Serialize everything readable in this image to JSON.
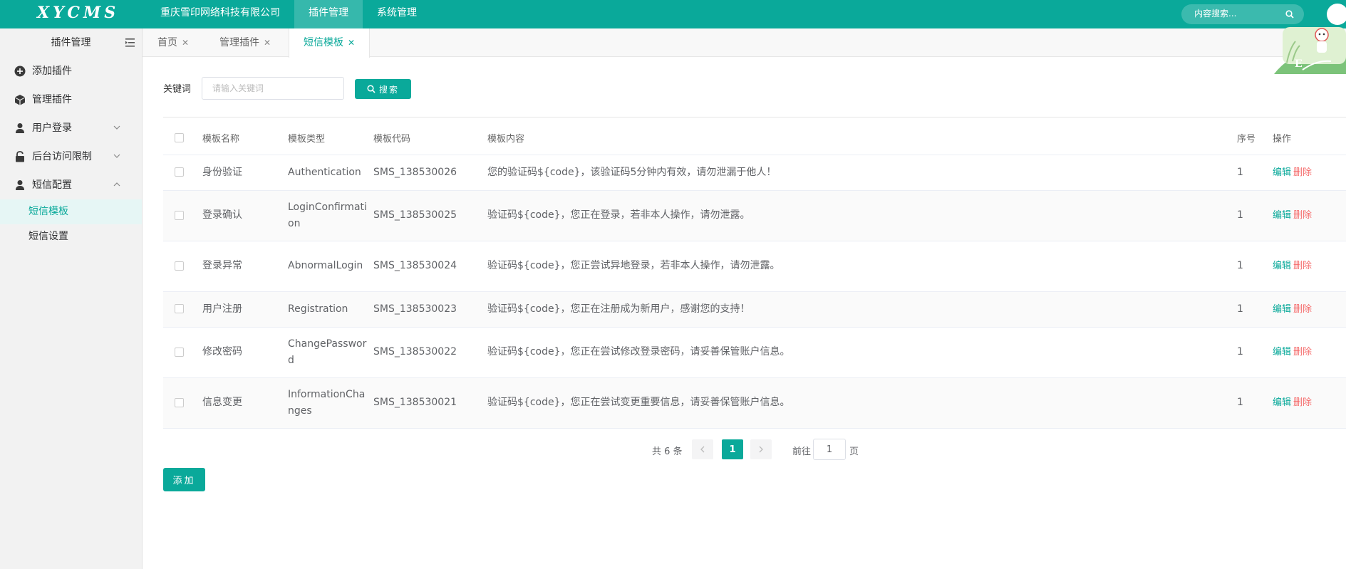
{
  "app": {
    "logo": "XYCMS"
  },
  "topnav": [
    {
      "label": "重庆雪印网络科技有限公司",
      "active": false
    },
    {
      "label": "插件管理",
      "active": true
    },
    {
      "label": "系统管理",
      "active": false
    }
  ],
  "top_search": {
    "placeholder": "内容搜索..."
  },
  "sidebar": {
    "title": "插件管理",
    "items": [
      {
        "label": "添加插件",
        "icon": "plus-circle-icon"
      },
      {
        "label": "管理插件",
        "icon": "cube-icon"
      },
      {
        "label": "用户登录",
        "icon": "user-icon",
        "expandable": true
      },
      {
        "label": "后台访问限制",
        "icon": "lock-icon",
        "expandable": true
      },
      {
        "label": "短信配置",
        "icon": "user-icon",
        "expanded": true
      }
    ],
    "subitems": [
      {
        "label": "短信模板",
        "active": true
      },
      {
        "label": "短信设置",
        "active": false
      }
    ]
  },
  "tabs": [
    {
      "label": "首页",
      "active": false
    },
    {
      "label": "管理插件",
      "active": false
    },
    {
      "label": "短信模板",
      "active": true
    }
  ],
  "filter": {
    "keyword_label": "关键词",
    "keyword_placeholder": "请输入关键词",
    "search_label": "搜索"
  },
  "table": {
    "headers": {
      "name": "模板名称",
      "type": "模板类型",
      "code": "模板代码",
      "content": "模板内容",
      "seq": "序号",
      "ops": "操作"
    },
    "rows": [
      {
        "name": "身份验证",
        "type": "Authentication",
        "code": "SMS_138530026",
        "content": "您的验证码${code}，该验证码5分钟内有效，请勿泄漏于他人！",
        "seq": "1"
      },
      {
        "name": "登录确认",
        "type": "LoginConfirmation",
        "code": "SMS_138530025",
        "content": "验证码${code}，您正在登录，若非本人操作，请勿泄露。",
        "seq": "1"
      },
      {
        "name": "登录异常",
        "type": "AbnormalLogin",
        "code": "SMS_138530024",
        "content": "验证码${code}，您正尝试异地登录，若非本人操作，请勿泄露。",
        "seq": "1"
      },
      {
        "name": "用户注册",
        "type": "Registration",
        "code": "SMS_138530023",
        "content": "验证码${code}，您正在注册成为新用户，感谢您的支持！",
        "seq": "1"
      },
      {
        "name": "修改密码",
        "type": "ChangePassword",
        "code": "SMS_138530022",
        "content": "验证码${code}，您正在尝试修改登录密码，请妥善保管账户信息。",
        "seq": "1"
      },
      {
        "name": "信息变更",
        "type": "InformationChanges",
        "code": "SMS_138530021",
        "content": "验证码${code}，您正在尝试变更重要信息，请妥善保管账户信息。",
        "seq": "1"
      }
    ],
    "edit_label": "编辑",
    "delete_label": "删除"
  },
  "pagination": {
    "total_text": "共 6 条",
    "current_page": "1",
    "goto_prefix": "前往",
    "goto_value": "1",
    "goto_suffix": "页"
  },
  "add_button": "添加",
  "colors": {
    "primary": "#0aa99a",
    "danger": "#f56c6c"
  }
}
